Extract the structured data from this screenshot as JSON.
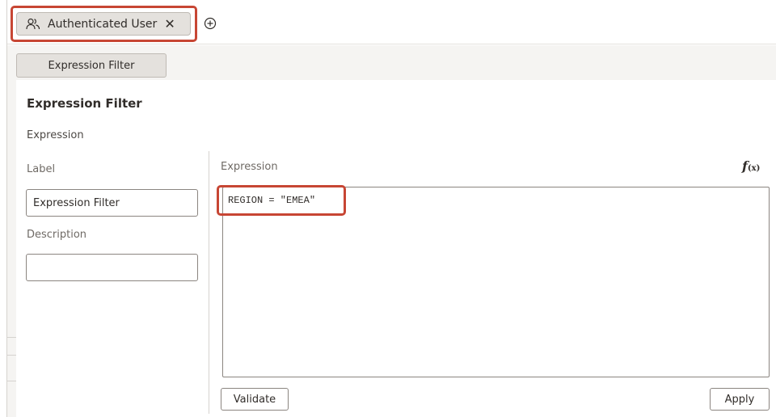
{
  "tab_chip": {
    "label": "Authenticated User",
    "icon": "users-icon",
    "close_icon": "close-icon"
  },
  "add_chip_icon": "add-circle-icon",
  "filter_button": {
    "label": "Expression Filter"
  },
  "panel": {
    "title": "Expression Filter",
    "subtitle": "Expression",
    "label_field": {
      "label": "Label",
      "value": "Expression Filter"
    },
    "description_field": {
      "label": "Description",
      "value": ""
    },
    "expression": {
      "label": "Expression",
      "fx_icon": "function-icon",
      "fx_main": "f",
      "fx_sub": "(x)",
      "code": "REGION = \"EMEA\""
    },
    "validate_label": "Validate",
    "apply_label": "Apply"
  },
  "colors": {
    "highlight": "#c74634",
    "chip_bg": "#e4e1dd",
    "toolbar_bg": "#f5f4f2"
  }
}
